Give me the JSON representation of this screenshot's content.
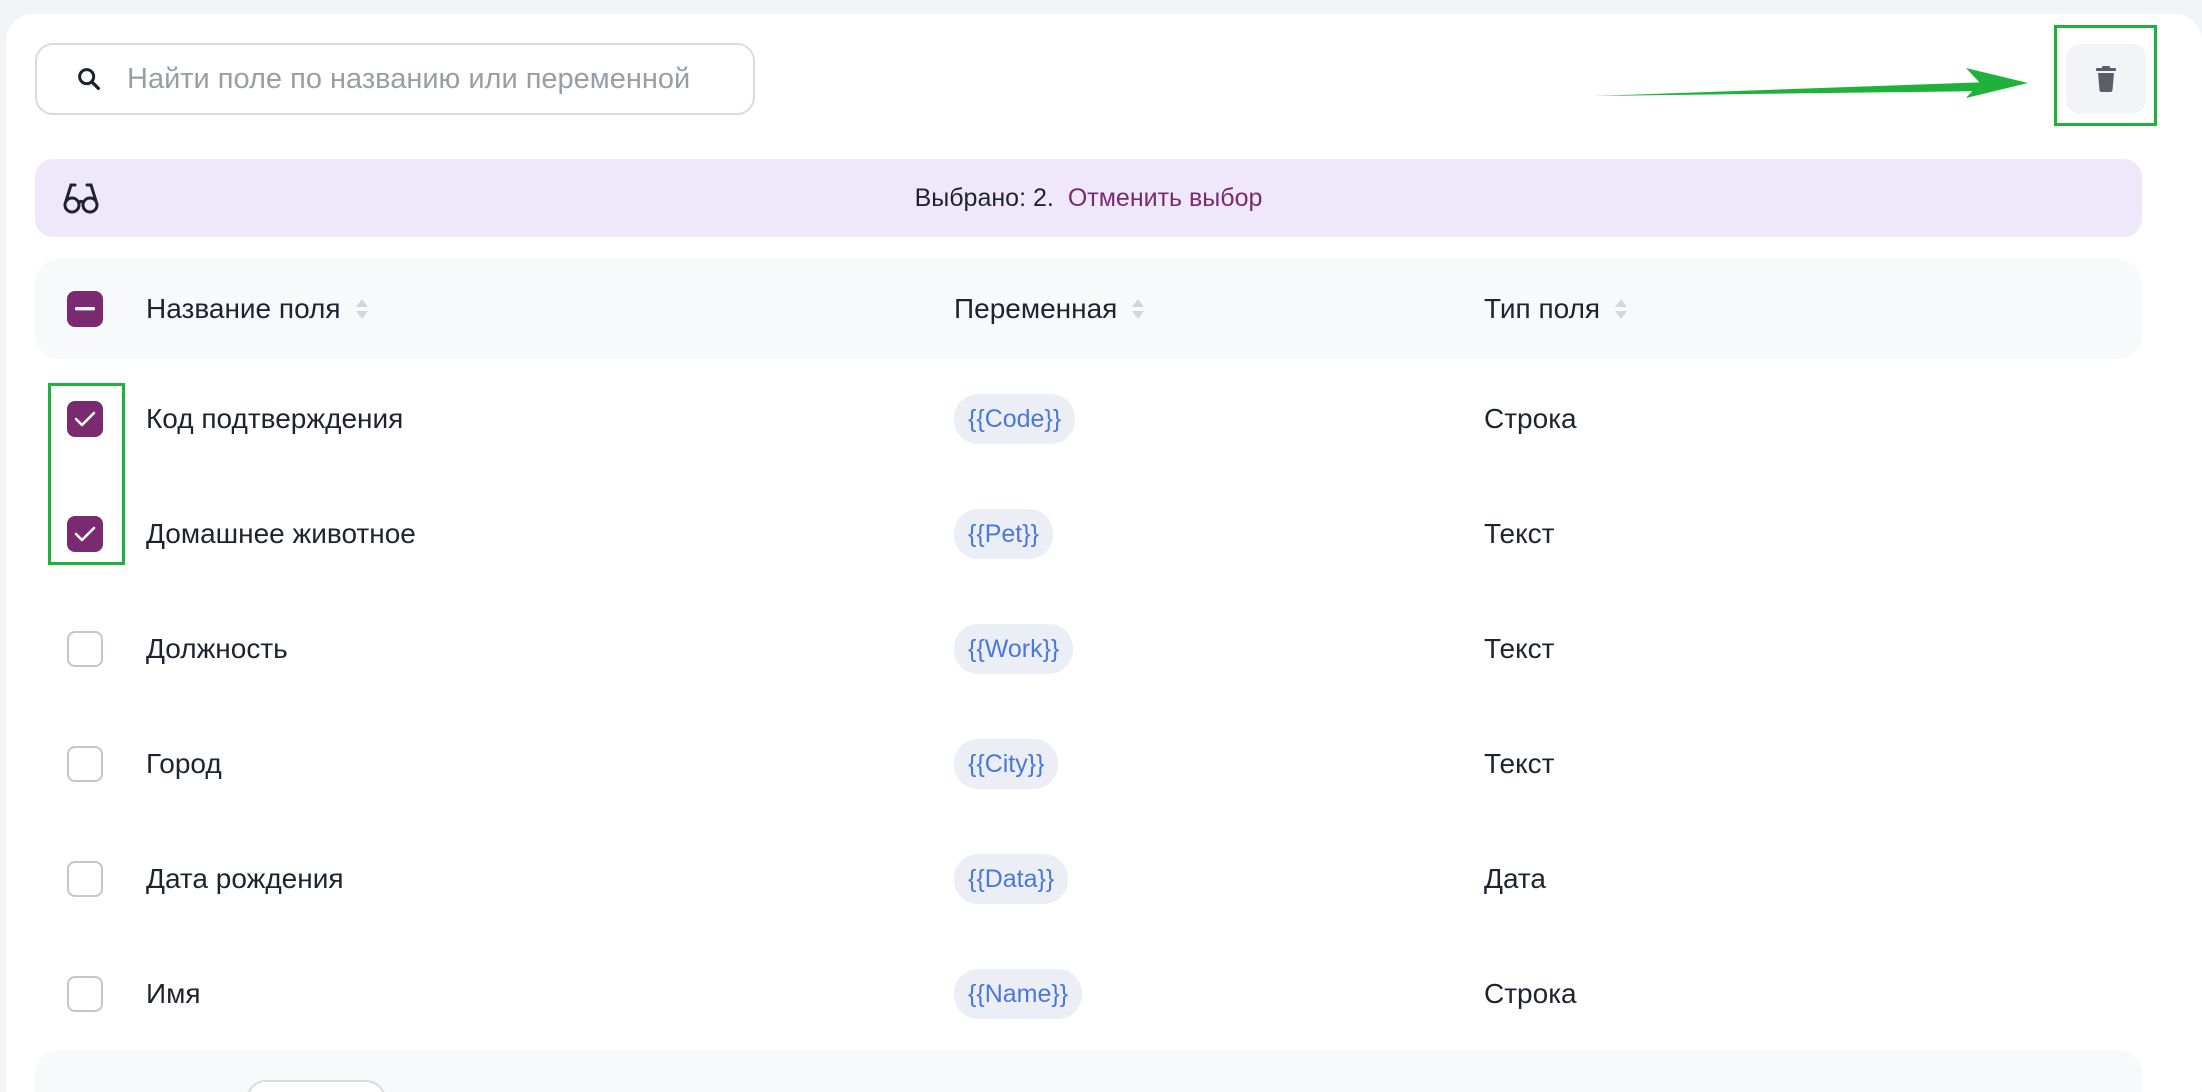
{
  "search": {
    "placeholder": "Найти поле по названию или переменной",
    "value": ""
  },
  "selection": {
    "count_text": "Выбрано: 2.",
    "cancel_label": "Отменить выбор"
  },
  "table": {
    "columns": [
      "Название поля",
      "Переменная",
      "Тип поля"
    ],
    "rows": [
      {
        "name": "Код подтверждения",
        "variable": "{{Code}}",
        "type": "Строка",
        "checked": true
      },
      {
        "name": "Домашнее животное",
        "variable": "{{Pet}}",
        "type": "Текст",
        "checked": true
      },
      {
        "name": "Должность",
        "variable": "{{Work}}",
        "type": "Текст",
        "checked": false
      },
      {
        "name": "Город",
        "variable": "{{City}}",
        "type": "Текст",
        "checked": false
      },
      {
        "name": "Дата рождения",
        "variable": "{{Data}}",
        "type": "Дата",
        "checked": false
      },
      {
        "name": "Имя",
        "variable": "{{Name}}",
        "type": "Строка",
        "checked": false
      }
    ]
  },
  "colors": {
    "accent": "#7a2a70",
    "chip_text": "#4a78d8",
    "selection_bg": "#efe8fb",
    "highlight": "#1fb23a"
  },
  "icons": {
    "search": "search-icon",
    "delete": "trash-icon",
    "selection": "glasses-icon",
    "sort": "sort-icon",
    "check": "check-icon"
  }
}
